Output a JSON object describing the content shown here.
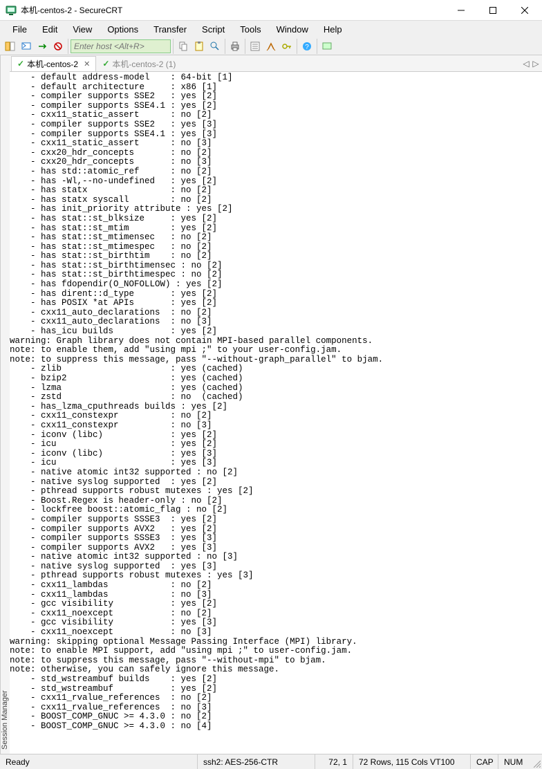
{
  "window": {
    "title": "本机-centos-2 - SecureCRT"
  },
  "menu": {
    "file": "File",
    "edit": "Edit",
    "view": "View",
    "options": "Options",
    "transfer": "Transfer",
    "script": "Script",
    "tools": "Tools",
    "window": "Window",
    "help": "Help"
  },
  "toolbar": {
    "host_placeholder": "Enter host <Alt+R>"
  },
  "side": {
    "label": "Session Manager"
  },
  "tabs": {
    "active": "本机-centos-2",
    "inactive": "本机-centos-2 (1)"
  },
  "status": {
    "ready": "Ready",
    "ssh": "ssh2: AES-256-CTR",
    "cursor": "72,  1",
    "size": "72 Rows, 115 Cols   VT100",
    "cap": "CAP",
    "num": "NUM"
  },
  "terminal": [
    "    - default address-model    : 64-bit [1]",
    "    - default architecture     : x86 [1]",
    "    - compiler supports SSE2   : yes [2]",
    "    - compiler supports SSE4.1 : yes [2]",
    "    - cxx11_static_assert      : no [2]",
    "    - compiler supports SSE2   : yes [3]",
    "    - compiler supports SSE4.1 : yes [3]",
    "    - cxx11_static_assert      : no [3]",
    "    - cxx20_hdr_concepts       : no [2]",
    "    - cxx20_hdr_concepts       : no [3]",
    "    - has std::atomic_ref      : no [2]",
    "    - has -Wl,--no-undefined   : yes [2]",
    "    - has statx                : no [2]",
    "    - has statx syscall        : no [2]",
    "    - has init_priority attribute : yes [2]",
    "    - has stat::st_blksize     : yes [2]",
    "    - has stat::st_mtim        : yes [2]",
    "    - has stat::st_mtimensec   : no [2]",
    "    - has stat::st_mtimespec   : no [2]",
    "    - has stat::st_birthtim    : no [2]",
    "    - has stat::st_birthtimensec : no [2]",
    "    - has stat::st_birthtimespec : no [2]",
    "    - has fdopendir(O_NOFOLLOW) : yes [2]",
    "    - has dirent::d_type       : yes [2]",
    "    - has POSIX *at APIs       : yes [2]",
    "    - cxx11_auto_declarations  : no [2]",
    "    - cxx11_auto_declarations  : no [3]",
    "    - has_icu builds           : yes [2]",
    "warning: Graph library does not contain MPI-based parallel components.",
    "note: to enable them, add \"using mpi ;\" to your user-config.jam.",
    "note: to suppress this message, pass \"--without-graph_parallel\" to bjam.",
    "    - zlib                     : yes (cached)",
    "    - bzip2                    : yes (cached)",
    "    - lzma                     : yes (cached)",
    "    - zstd                     : no  (cached)",
    "    - has_lzma_cputhreads builds : yes [2]",
    "    - cxx11_constexpr          : no [2]",
    "    - cxx11_constexpr          : no [3]",
    "    - iconv (libc)             : yes [2]",
    "    - icu                      : yes [2]",
    "    - iconv (libc)             : yes [3]",
    "    - icu                      : yes [3]",
    "    - native atomic int32 supported : no [2]",
    "    - native syslog supported  : yes [2]",
    "    - pthread supports robust mutexes : yes [2]",
    "    - Boost.Regex is header-only : no [2]",
    "    - lockfree boost::atomic_flag : no [2]",
    "    - compiler supports SSSE3  : yes [2]",
    "    - compiler supports AVX2   : yes [2]",
    "    - compiler supports SSSE3  : yes [3]",
    "    - compiler supports AVX2   : yes [3]",
    "    - native atomic int32 supported : no [3]",
    "    - native syslog supported  : yes [3]",
    "    - pthread supports robust mutexes : yes [3]",
    "    - cxx11_lambdas            : no [2]",
    "    - cxx11_lambdas            : no [3]",
    "    - gcc visibility           : yes [2]",
    "    - cxx11_noexcept           : no [2]",
    "    - gcc visibility           : yes [3]",
    "    - cxx11_noexcept           : no [3]",
    "warning: skipping optional Message Passing Interface (MPI) library.",
    "note: to enable MPI support, add \"using mpi ;\" to user-config.jam.",
    "note: to suppress this message, pass \"--without-mpi\" to bjam.",
    "note: otherwise, you can safely ignore this message.",
    "    - std_wstreambuf builds    : yes [2]",
    "    - std_wstreambuf           : yes [2]",
    "    - cxx11_rvalue_references  : no [2]",
    "    - cxx11_rvalue_references  : no [3]",
    "    - BOOST_COMP_GNUC >= 4.3.0 : no [2]",
    "    - BOOST_COMP_GNUC >= 4.3.0 : no [4]"
  ]
}
